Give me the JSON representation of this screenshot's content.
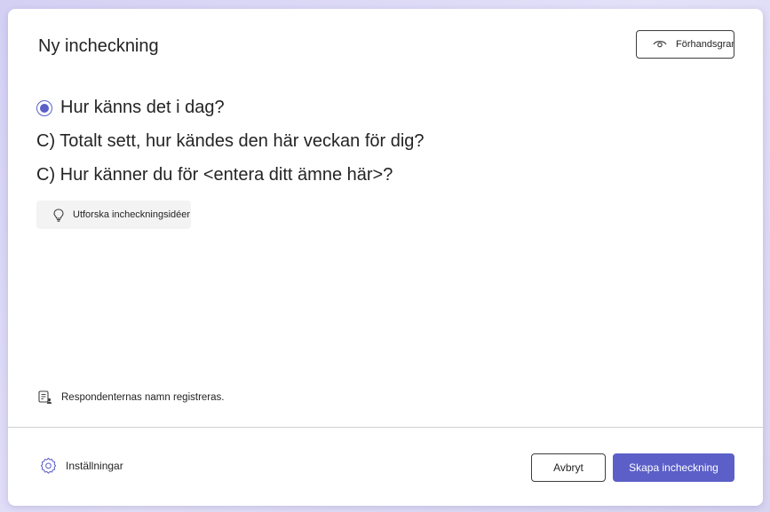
{
  "dialog": {
    "title": "Ny incheckning",
    "preview_label": "Förhandsgranskning",
    "questions": [
      "Hur känns det i dag?",
      "C) Totalt sett, hur kändes den här veckan för dig?",
      "C) Hur känner du för <entera ditt ämne här>?"
    ],
    "explore_label": "Utforska incheckningsidéer",
    "notice": "Respondenternas namn registreras.",
    "settings_label": "Inställningar",
    "cancel_label": "Avbryt",
    "create_label": "Skapa incheckning"
  },
  "colors": {
    "accent": "#5b5fc7",
    "background": "#d9d6f3"
  },
  "icons": {
    "preview": "eye-icon",
    "explore": "lightbulb-icon",
    "notice": "form-person-icon",
    "settings": "gear-icon",
    "selected": "radio-selected-icon"
  }
}
